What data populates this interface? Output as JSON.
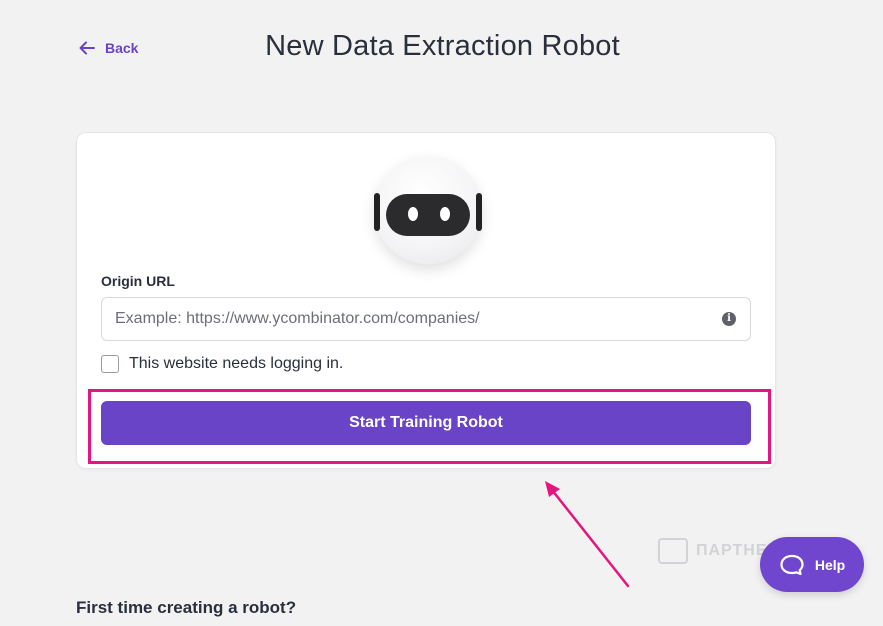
{
  "header": {
    "back_label": "Back",
    "title": "New Data Extraction Robot"
  },
  "form": {
    "origin_label": "Origin URL",
    "url_value": "",
    "url_placeholder": "Example: https://www.ycombinator.com/companies/",
    "login_checkbox_label": "This website needs logging in.",
    "login_checked": false,
    "start_button_label": "Start Training Robot"
  },
  "help": {
    "label": "Help"
  },
  "footer": {
    "first_time_heading": "First time creating a robot?"
  },
  "watermark": {
    "text": "ПАРТНЕРКИН"
  },
  "colors": {
    "accent": "#6a44c7",
    "highlight": "#e5157f",
    "background": "#f2f2f3"
  },
  "icons": {
    "back": "arrow-left-icon",
    "info": "info-icon",
    "help": "chat-bubble-icon",
    "robot": "robot-avatar-icon"
  }
}
